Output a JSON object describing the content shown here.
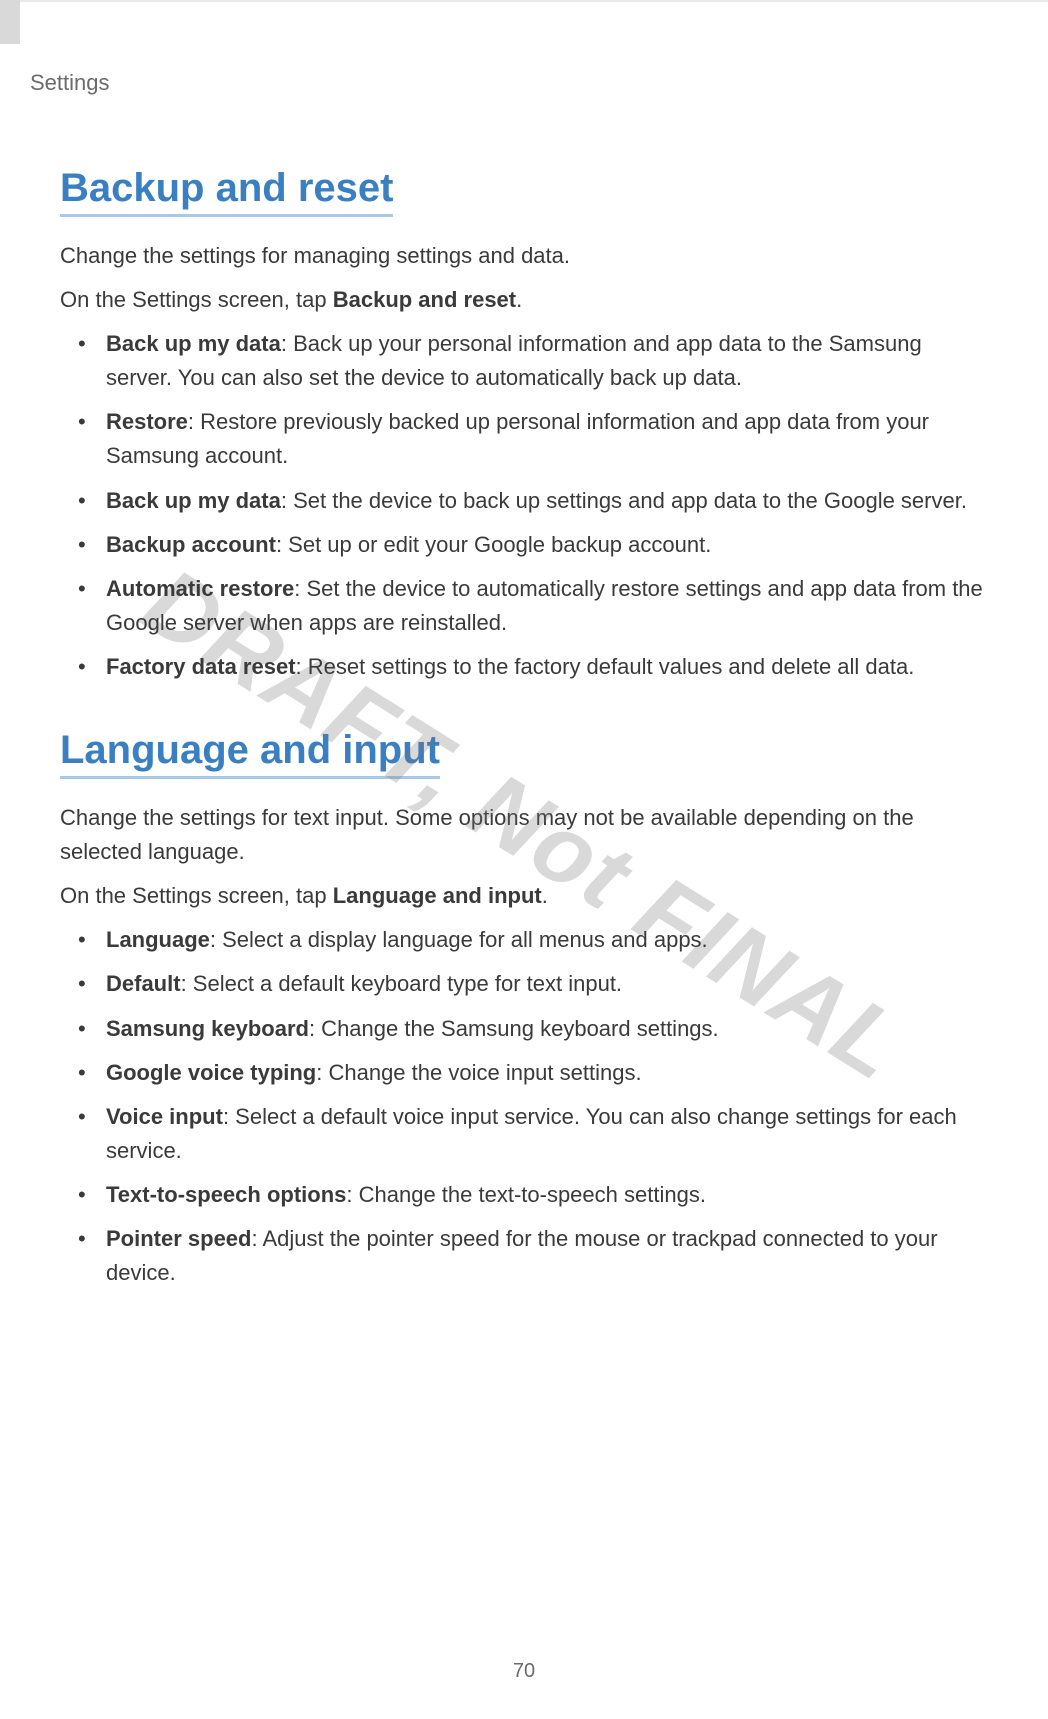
{
  "breadcrumb": "Settings",
  "watermark": "DRAFT, Not FINAL",
  "page_number": "70",
  "sections": [
    {
      "title": "Backup and reset",
      "intro_plain": "Change the settings for managing settings and data.",
      "intro_prefix": "On the Settings screen, tap ",
      "intro_bold": "Backup and reset",
      "intro_suffix": ".",
      "items": [
        {
          "term": "Back up my data",
          "desc": ": Back up your personal information and app data to the Samsung server. You can also set the device to automatically back up data."
        },
        {
          "term": "Restore",
          "desc": ": Restore previously backed up personal information and app data from your Samsung account."
        },
        {
          "term": "Back up my data",
          "desc": ": Set the device to back up settings and app data to the Google server."
        },
        {
          "term": "Backup account",
          "desc": ": Set up or edit your Google backup account."
        },
        {
          "term": "Automatic restore",
          "desc": ": Set the device to automatically restore settings and app data from the Google server when apps are reinstalled."
        },
        {
          "term": "Factory data reset",
          "desc": ": Reset settings to the factory default values and delete all data."
        }
      ]
    },
    {
      "title": "Language and input",
      "intro_plain": "Change the settings for text input. Some options may not be available depending on the selected language.",
      "intro_prefix": "On the Settings screen, tap ",
      "intro_bold": "Language and input",
      "intro_suffix": ".",
      "items": [
        {
          "term": "Language",
          "desc": ": Select a display language for all menus and apps."
        },
        {
          "term": "Default",
          "desc": ": Select a default keyboard type for text input."
        },
        {
          "term": "Samsung keyboard",
          "desc": ": Change the Samsung keyboard settings."
        },
        {
          "term": "Google voice typing",
          "desc": ": Change the voice input settings."
        },
        {
          "term": "Voice input",
          "desc": ": Select a default voice input service. You can also change settings for each service."
        },
        {
          "term": "Text-to-speech options",
          "desc": ": Change the text-to-speech settings."
        },
        {
          "term": "Pointer speed",
          "desc": ": Adjust the pointer speed for the mouse or trackpad connected to your device."
        }
      ]
    }
  ]
}
